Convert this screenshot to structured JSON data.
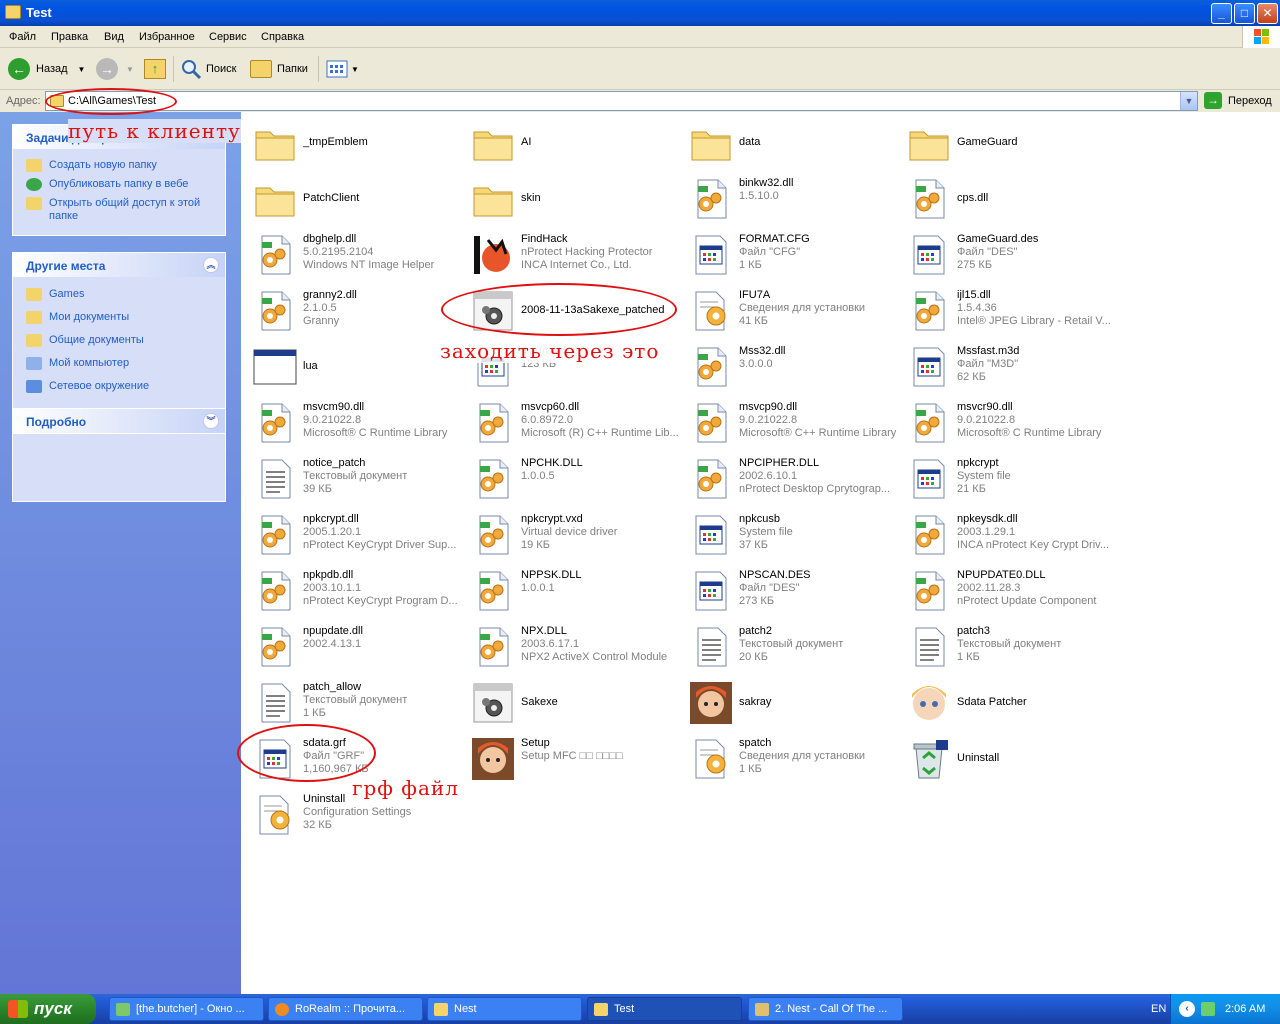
{
  "window": {
    "title": "Test"
  },
  "menu": [
    "Файл",
    "Правка",
    "Вид",
    "Избранное",
    "Сервис",
    "Справка"
  ],
  "toolbar": {
    "back": "Назад",
    "search": "Поиск",
    "folders": "Папки"
  },
  "address": {
    "label": "Адрес:",
    "path": "C:\\All\\Games\\Test",
    "go": "Переход"
  },
  "sidebar": {
    "tasks": {
      "title": "Задачи для файлов и папок",
      "items": [
        "Создать новую папку",
        "Опубликовать папку в вебе",
        "Открыть общий доступ к этой папке"
      ]
    },
    "places": {
      "title": "Другие места",
      "items": [
        "Games",
        "Мои документы",
        "Общие документы",
        "Мой компьютер",
        "Сетевое окружение"
      ]
    },
    "details": {
      "title": "Подробно"
    }
  },
  "files": [
    {
      "name": "_tmpEmblem",
      "d1": "",
      "d2": "",
      "icon": "folder-icon"
    },
    {
      "name": "AI",
      "d1": "",
      "d2": "",
      "icon": "folder-icon"
    },
    {
      "name": "data",
      "d1": "",
      "d2": "",
      "icon": "folder-icon"
    },
    {
      "name": "GameGuard",
      "d1": "",
      "d2": "",
      "icon": "folder-icon"
    },
    {
      "name": "PatchClient",
      "d1": "",
      "d2": "",
      "icon": "folder-icon"
    },
    {
      "name": "skin",
      "d1": "",
      "d2": "",
      "icon": "folder-icon"
    },
    {
      "name": "binkw32.dll",
      "d1": "1.5.10.0",
      "d2": "",
      "icon": "dll-icon"
    },
    {
      "name": "cps.dll",
      "d1": "",
      "d2": "",
      "icon": "dll-icon"
    },
    {
      "name": "dbghelp.dll",
      "d1": "5.0.2195.2104",
      "d2": "Windows NT Image Helper",
      "icon": "dll-icon"
    },
    {
      "name": "FindHack",
      "d1": "nProtect Hacking Protector",
      "d2": "INCA Internet Co., Ltd.",
      "icon": "findhack-icon"
    },
    {
      "name": "FORMAT.CFG",
      "d1": "Файл \"CFG\"",
      "d2": "1 КБ",
      "icon": "file-window-icon"
    },
    {
      "name": "GameGuard.des",
      "d1": "Файл \"DES\"",
      "d2": "275 КБ",
      "icon": "file-window-icon"
    },
    {
      "name": "granny2.dll",
      "d1": "2.1.0.5",
      "d2": "Granny",
      "icon": "dll-icon"
    },
    {
      "name": "2008-11-13aSakexe_patched",
      "d1": "",
      "d2": "",
      "icon": "exe-gear-icon"
    },
    {
      "name": "IFU7A",
      "d1": "Сведения для установки",
      "d2": "41 КБ",
      "icon": "setup-info-icon"
    },
    {
      "name": "ijl15.dll",
      "d1": "1.5.4.36",
      "d2": "Intel® JPEG Library - Retail V...",
      "icon": "dll-icon"
    },
    {
      "name": "lua",
      "d1": "",
      "d2": "",
      "icon": "app-window-icon"
    },
    {
      "name": "",
      "d1": "Файл \"ASI\"",
      "d2": "123 КБ",
      "icon": "file-window-icon"
    },
    {
      "name": "Mss32.dll",
      "d1": "3.0.0.0",
      "d2": "",
      "icon": "dll-icon"
    },
    {
      "name": "Mssfast.m3d",
      "d1": "Файл \"M3D\"",
      "d2": "62 КБ",
      "icon": "file-window-icon"
    },
    {
      "name": "msvcm90.dll",
      "d1": "9.0.21022.8",
      "d2": "Microsoft® C Runtime Library",
      "icon": "dll-icon"
    },
    {
      "name": "msvcp60.dll",
      "d1": "6.0.8972.0",
      "d2": "Microsoft (R) C++ Runtime Lib...",
      "icon": "dll-icon"
    },
    {
      "name": "msvcp90.dll",
      "d1": "9.0.21022.8",
      "d2": "Microsoft® C++ Runtime Library",
      "icon": "dll-icon"
    },
    {
      "name": "msvcr90.dll",
      "d1": "9.0.21022.8",
      "d2": "Microsoft® C Runtime Library",
      "icon": "dll-icon"
    },
    {
      "name": "notice_patch",
      "d1": "Текстовый документ",
      "d2": "39 КБ",
      "icon": "text-file-icon"
    },
    {
      "name": "NPCHK.DLL",
      "d1": "1.0.0.5",
      "d2": "",
      "icon": "dll-icon"
    },
    {
      "name": "NPCIPHER.DLL",
      "d1": "2002.6.10.1",
      "d2": "nProtect Desktop Cprytograp...",
      "icon": "dll-icon"
    },
    {
      "name": "npkcrypt",
      "d1": "System file",
      "d2": "21 КБ",
      "icon": "file-window-icon"
    },
    {
      "name": "npkcrypt.dll",
      "d1": "2005.1.20.1",
      "d2": "nProtect KeyCrypt Driver Sup...",
      "icon": "dll-icon"
    },
    {
      "name": "npkcrypt.vxd",
      "d1": "Virtual device driver",
      "d2": "19 КБ",
      "icon": "dll-icon"
    },
    {
      "name": "npkcusb",
      "d1": "System file",
      "d2": "37 КБ",
      "icon": "file-window-icon"
    },
    {
      "name": "npkeysdk.dll",
      "d1": "2003.1.29.1",
      "d2": "INCA nProtect Key Crypt Driv...",
      "icon": "dll-icon"
    },
    {
      "name": "npkpdb.dll",
      "d1": "2003.10.1.1",
      "d2": "nProtect KeyCrypt Program D...",
      "icon": "dll-icon"
    },
    {
      "name": "NPPSK.DLL",
      "d1": "1.0.0.1",
      "d2": "",
      "icon": "dll-icon"
    },
    {
      "name": "NPSCAN.DES",
      "d1": "Файл \"DES\"",
      "d2": "273 КБ",
      "icon": "file-window-icon"
    },
    {
      "name": "NPUPDATE0.DLL",
      "d1": "2002.11.28.3",
      "d2": "nProtect Update Component",
      "icon": "dll-icon"
    },
    {
      "name": "npupdate.dll",
      "d1": "2002.4.13.1",
      "d2": "",
      "icon": "dll-icon"
    },
    {
      "name": "NPX.DLL",
      "d1": "2003.6.17.1",
      "d2": "NPX2 ActiveX Control Module",
      "icon": "dll-icon"
    },
    {
      "name": "patch2",
      "d1": "Текстовый документ",
      "d2": "20 КБ",
      "icon": "text-file-icon"
    },
    {
      "name": "patch3",
      "d1": "Текстовый документ",
      "d2": "1 КБ",
      "icon": "text-file-icon"
    },
    {
      "name": "patch_allow",
      "d1": "Текстовый документ",
      "d2": "1 КБ",
      "icon": "text-file-icon"
    },
    {
      "name": "Sakexe",
      "d1": "",
      "d2": "",
      "icon": "exe-gear-icon"
    },
    {
      "name": "sakray",
      "d1": "",
      "d2": "",
      "icon": "character-portrait-icon"
    },
    {
      "name": "Sdata Patcher",
      "d1": "",
      "d2": "",
      "icon": "character-face-icon"
    },
    {
      "name": "sdata.grf",
      "d1": "Файл \"GRF\"",
      "d2": "1,160,967 КБ",
      "icon": "file-window-icon"
    },
    {
      "name": "Setup",
      "d1": "Setup MFC □□ □□□□",
      "d2": "",
      "icon": "character-portrait-icon"
    },
    {
      "name": "spatch",
      "d1": "Сведения для установки",
      "d2": "1 КБ",
      "icon": "setup-info-icon"
    },
    {
      "name": "Uninstall",
      "d1": "",
      "d2": "",
      "icon": "recycle-bin-icon"
    },
    {
      "name": "Uninstall",
      "d1": "Configuration Settings",
      "d2": "32 КБ",
      "icon": "setup-info-icon"
    }
  ],
  "annotations": {
    "client_path": "путь к клиенту",
    "enter_through": "заходить через это",
    "grf_file": "грф файл"
  },
  "taskbar": {
    "start": "пуск",
    "tasks": [
      "[the.butcher] - Окно ...",
      "RoRealm :: Прочита...",
      "Nest",
      "Test",
      "2. Nest - Call Of The ..."
    ],
    "language": "EN",
    "clock": "2:06 AM"
  }
}
